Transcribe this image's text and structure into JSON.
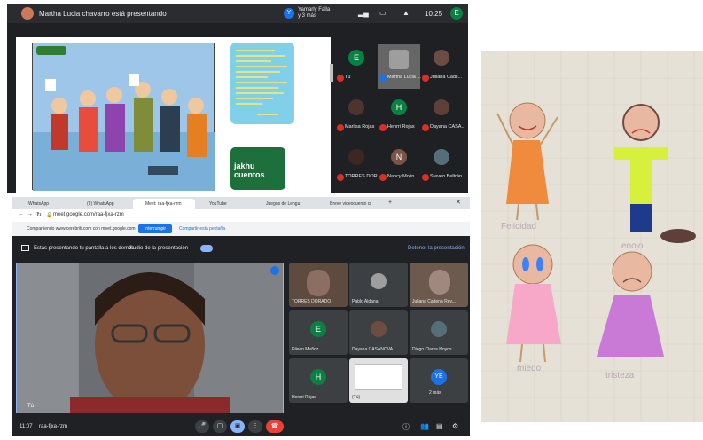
{
  "top_call": {
    "presenter_banner": "Martha Lucia chavarro está presentando",
    "viewer_chip": {
      "initial": "Y",
      "name": "Yamarly Falla",
      "more": "y 3 más"
    },
    "clock": "10:25",
    "self_initial": "E",
    "story_card_title": "jakhu cuentos",
    "participants": [
      {
        "initial": "E",
        "name": "Tú",
        "color": "#0b8043"
      },
      {
        "initial": "",
        "name": "Martha Lucia ...",
        "color": "#555555"
      },
      {
        "initial": "",
        "name": "Juliana Cadil...",
        "color": "#6d4c41"
      },
      {
        "initial": "",
        "name": "Marlisa Rojas",
        "color": "#4e342e"
      },
      {
        "initial": "H",
        "name": "Henrri Rojas",
        "color": "#0b8043"
      },
      {
        "initial": "",
        "name": "Dayana CASA...",
        "color": "#5d4037"
      },
      {
        "initial": "",
        "name": "TORRES DOR...",
        "color": "#3e2723"
      },
      {
        "initial": "N",
        "name": "Nancy Mojin",
        "color": "#795548"
      },
      {
        "initial": "",
        "name": "Steven Beltrán",
        "color": "#546e7a"
      }
    ]
  },
  "bottom_call": {
    "tabs": [
      {
        "label": "WhatsApp"
      },
      {
        "label": "(9) WhatsApp"
      },
      {
        "label": "Meet: raa-fjxa-rzm"
      },
      {
        "label": "YouTube"
      },
      {
        "label": "Juegos de Lengu"
      },
      {
        "label": "Breve videocuento cr"
      }
    ],
    "url": "meet.google.com/raa-fjxa-rzm",
    "share_bar": {
      "text": "Compartiendo www.cerebriti.com con meet.google.com",
      "stop_label": "Interrumpir",
      "share_this_label": "Compartir esta pestaña"
    },
    "presenting": {
      "text": "Estás presentando tu pantalla a los demás",
      "audio_label": "Audio de la presentación",
      "stop_label": "Detener la presentación"
    },
    "main_tile_name": "Tú",
    "tiles": [
      {
        "name": "TORRES DORADO",
        "initial": "",
        "color": "#6d4c41"
      },
      {
        "name": "Pablo Aldana",
        "initial": "",
        "color": "#5f6368"
      },
      {
        "name": "Juliana Cadena Rey...",
        "initial": "",
        "color": "#8d6e63"
      },
      {
        "name": "Eileen Muñoz",
        "initial": "E",
        "color": "#0b8043"
      },
      {
        "name": "Dayana CASANOVA ...",
        "initial": "",
        "color": "#6d4c41"
      },
      {
        "name": "Diego Claros Hoyos",
        "initial": "",
        "color": "#546e7a"
      },
      {
        "name": "Henrri Rojas",
        "initial": "H",
        "color": "#0b8043"
      },
      {
        "name": "(Tú)",
        "initial": "",
        "color": "#bdbdbd"
      },
      {
        "name": "2 más",
        "initial": "YE",
        "color": "#1a73e8"
      }
    ],
    "meeting_code": "raa-fjxa-rzm",
    "time": "11:07"
  },
  "drawing": {
    "labels": [
      "Felicidad",
      "enojo",
      "miedo",
      "tristeza"
    ]
  }
}
